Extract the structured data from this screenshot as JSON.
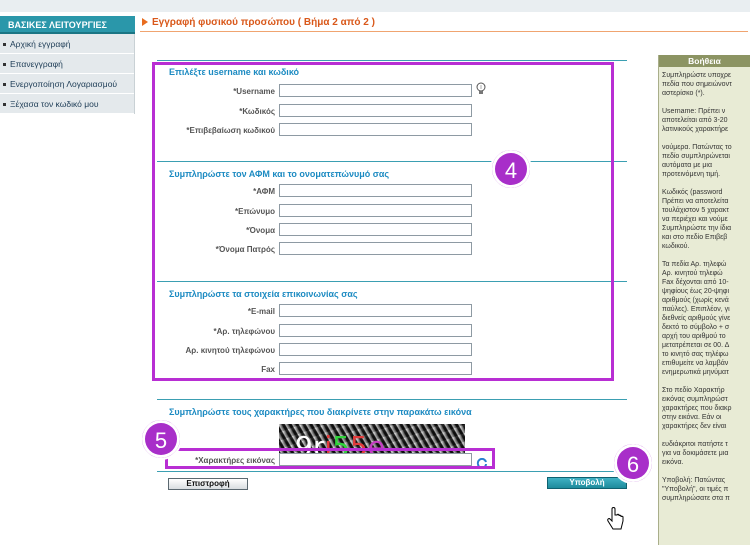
{
  "sidebar": {
    "header": "ΒΑΣΙΚΕΣ ΛΕΙΤΟΥΡΓΙΕΣ",
    "items": [
      {
        "label": "Αρχική εγγραφή"
      },
      {
        "label": "Επανεγγραφή"
      },
      {
        "label": "Ενεργοποίηση Λογαριασμού"
      },
      {
        "label": "Ξέχασα τον κωδικό μου"
      }
    ]
  },
  "page": {
    "title": "Εγγραφή φυσικού προσώπου ( Βήμα 2 από 2 )"
  },
  "sections": {
    "credentials": {
      "title": "Επιλέξτε username και κωδικό",
      "username_label": "*Username",
      "password_label": "*Κωδικός",
      "confirm_label": "*Επιβεβαίωση κωδικού"
    },
    "identity": {
      "title": "Συμπληρώστε τον ΑΦΜ και το ονοματεπώνυμό σας",
      "afm_label": "*ΑΦΜ",
      "surname_label": "*Επώνυμο",
      "name_label": "*Όνομα",
      "father_label": "*Όνομα Πατρός"
    },
    "contact": {
      "title": "Συμπληρώστε τα στοιχεία επικοινωνίας σας",
      "email_label": "*E-mail",
      "phone_label": "*Αρ. τηλεφώνου",
      "mobile_label": "Αρ. κινητού τηλεφώνου",
      "fax_label": "Fax"
    },
    "captcha": {
      "title": "Συμπληρώστε τους χαρακτήρες που διακρίνετε στην παρακάτω εικόνα",
      "code_chars": [
        "9",
        "r",
        "i",
        "5",
        "5",
        "e"
      ],
      "code_colors": [
        "#ffffff",
        "#ffffff",
        "#e23b3b",
        "#2fd33a",
        "#e23b3b",
        "#c33fc0"
      ],
      "field_label": "*Χαρακτήρες εικόνας"
    }
  },
  "buttons": {
    "back": "Επιστροφή",
    "submit": "Υποβολή"
  },
  "annotations": {
    "badge_4": "4",
    "badge_5": "5",
    "badge_6": "6",
    "highlight_color": "#b82ed3"
  },
  "help": {
    "title": "Βοήθεια",
    "lines": [
      "Συμπληρώστε υποχρε",
      "πεδία που σημειώνοντ",
      "αστερίσκο (*).",
      "",
      "Username: Πρέπει ν",
      "αποτελείται από 3-20",
      "λατινικούς χαρακτήρε",
      "",
      "νούμερα. Πατώντας το",
      "πεδίο συμπληρώνεται",
      "αυτόματα με μια",
      "προτεινόμενη τιμή.",
      "",
      "Κωδικός (password",
      "Πρέπει να αποτελείτα",
      "τουλάχιστον 5 χαρακτ",
      "να περιέχει και νούμε",
      "Συμπληρώστε την ίδια",
      "και στο πεδίο Επιβεβ",
      "κωδικού.",
      "",
      "Τα πεδία Αρ. τηλεφώ",
      "Αρ. κινητού τηλεφώ",
      "Fax δέχονται από 10-",
      "ψηφίους έως 20-ψηφι",
      "αριθμούς (χωρίς κενά",
      "παύλες). Επιπλέον, γι",
      "διεθνείς αριθμούς γίνε",
      "δεκτό το σύμβολο + σ",
      "αρχή του αριθμού το",
      "μετατρέπεται σε 00. Δ",
      "το κινητό σας τηλέφω",
      "επιθυμείτε να λαμβάν",
      "ενημερωτικά μηνύματ",
      "",
      "Στο πεδίο Χαρακτήρ",
      "εικόνας συμπληρώστ",
      "χαρακτήρες που διακρ",
      "στην εικόνα. Εάν οι",
      "χαρακτήρες δεν είναι",
      "",
      "ευδιάκριτοι πατήστε τ",
      "για να δοκιμάσετε μια",
      "εικόνα.",
      "",
      "Υποβολή: Πατώντας",
      "\"Υποβολή\", οι τιμές π",
      "συμπληρώσατε στα π"
    ]
  }
}
